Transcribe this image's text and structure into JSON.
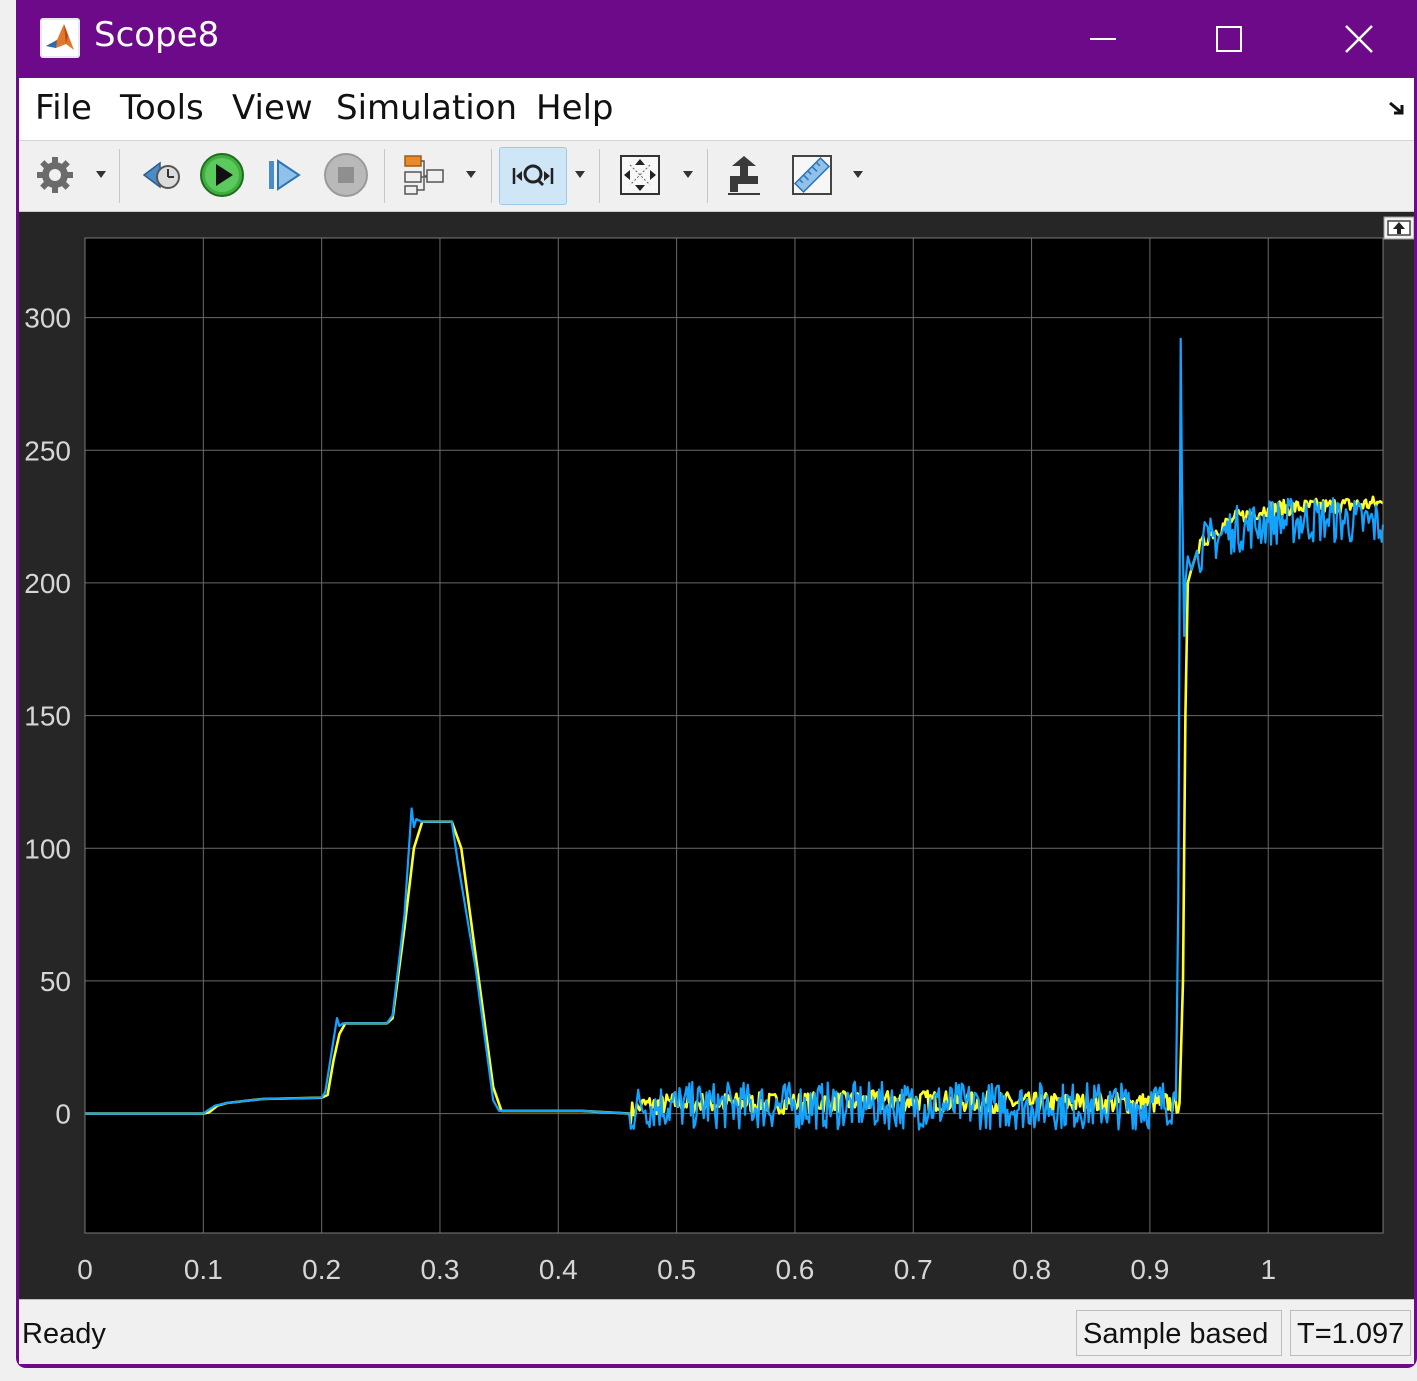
{
  "window": {
    "title": "Scope8",
    "controls": {
      "minimize": "minimize",
      "maximize": "maximize",
      "close": "close"
    }
  },
  "menu": {
    "items": [
      {
        "label": "File"
      },
      {
        "label": "Tools"
      },
      {
        "label": "View"
      },
      {
        "label": "Simulation"
      },
      {
        "label": "Help"
      }
    ]
  },
  "toolbar": {
    "buttons": [
      {
        "icon": "gear-icon"
      },
      {
        "icon": "step-back-icon"
      },
      {
        "icon": "run-icon"
      },
      {
        "icon": "step-forward-icon"
      },
      {
        "icon": "stop-icon"
      },
      {
        "icon": "signal-trigger-icon"
      },
      {
        "icon": "zoom-x-icon"
      },
      {
        "icon": "fit-to-view-icon"
      },
      {
        "icon": "cursor-measure-icon"
      },
      {
        "icon": "measurement-ruler-icon"
      }
    ]
  },
  "status": {
    "text": "Ready",
    "mode": "Sample based",
    "time": "T=1.097"
  },
  "colors": {
    "title_bar": "#6c0a8a",
    "plot_bg": "#000000",
    "figure_bg": "#262626",
    "grid": "#6a6a6a",
    "series_1": "#ffff26",
    "series_2": "#14a2ff"
  },
  "chart_data": {
    "type": "line",
    "title": "",
    "xlabel": "",
    "ylabel": "",
    "xlim": [
      0,
      1.097
    ],
    "ylim": [
      -45,
      330
    ],
    "x_ticks": [
      0,
      0.1,
      0.2,
      0.3,
      0.4,
      0.5,
      0.6,
      0.7,
      0.8,
      0.9,
      1
    ],
    "x_tick_labels": [
      "0",
      "0.1",
      "0.2",
      "0.3",
      "0.4",
      "0.5",
      "0.6",
      "0.7",
      "0.8",
      "0.9",
      "1"
    ],
    "y_ticks": [
      0,
      50,
      100,
      150,
      200,
      250,
      300
    ],
    "y_tick_labels": [
      "0",
      "50",
      "100",
      "150",
      "200",
      "250",
      "300"
    ],
    "grid": true,
    "legend": "none",
    "series": [
      {
        "color": "#ffff26",
        "x": [
          0,
          0.1,
          0.105,
          0.112,
          0.12,
          0.15,
          0.2,
          0.205,
          0.21,
          0.215,
          0.22,
          0.255,
          0.26,
          0.27,
          0.278,
          0.285,
          0.31,
          0.318,
          0.33,
          0.345,
          0.352,
          0.36,
          0.42,
          0.46,
          0.47,
          0.5,
          0.6,
          0.7,
          0.8,
          0.9,
          0.925,
          0.928,
          0.93,
          0.932,
          0.935,
          0.94,
          0.95,
          0.97,
          1.0,
          1.05,
          1.097
        ],
        "y": [
          0,
          0,
          0.5,
          3,
          4,
          5.5,
          6,
          7,
          20,
          30,
          34,
          34,
          36,
          70,
          100,
          110,
          110,
          100,
          60,
          10,
          1,
          1,
          1,
          0,
          3,
          4,
          4,
          5,
          4,
          4,
          4,
          50,
          150,
          200,
          205,
          212,
          218,
          224,
          228,
          229,
          230
        ]
      },
      {
        "color": "#14a2ff",
        "x": [
          0,
          0.1,
          0.103,
          0.11,
          0.12,
          0.15,
          0.2,
          0.203,
          0.208,
          0.213,
          0.215,
          0.218,
          0.22,
          0.255,
          0.26,
          0.27,
          0.276,
          0.278,
          0.28,
          0.285,
          0.31,
          0.315,
          0.33,
          0.345,
          0.35,
          0.36,
          0.42,
          0.46,
          0.47,
          0.5,
          0.6,
          0.7,
          0.8,
          0.9,
          0.922,
          0.924,
          0.926,
          0.927,
          0.929,
          0.93,
          0.932,
          0.935,
          0.94,
          0.95,
          0.97,
          1.0,
          1.05,
          1.097
        ],
        "y": [
          0,
          0,
          1,
          3,
          4,
          5.5,
          6,
          8,
          22,
          36,
          33,
          34,
          34,
          34,
          37,
          75,
          115,
          108,
          111,
          110,
          110,
          95,
          55,
          5,
          1,
          1,
          1,
          0,
          3,
          3,
          3,
          3,
          3,
          3,
          5,
          80,
          292,
          240,
          180,
          200,
          210,
          205,
          212,
          216,
          220,
          223,
          224,
          222
        ]
      }
    ]
  }
}
